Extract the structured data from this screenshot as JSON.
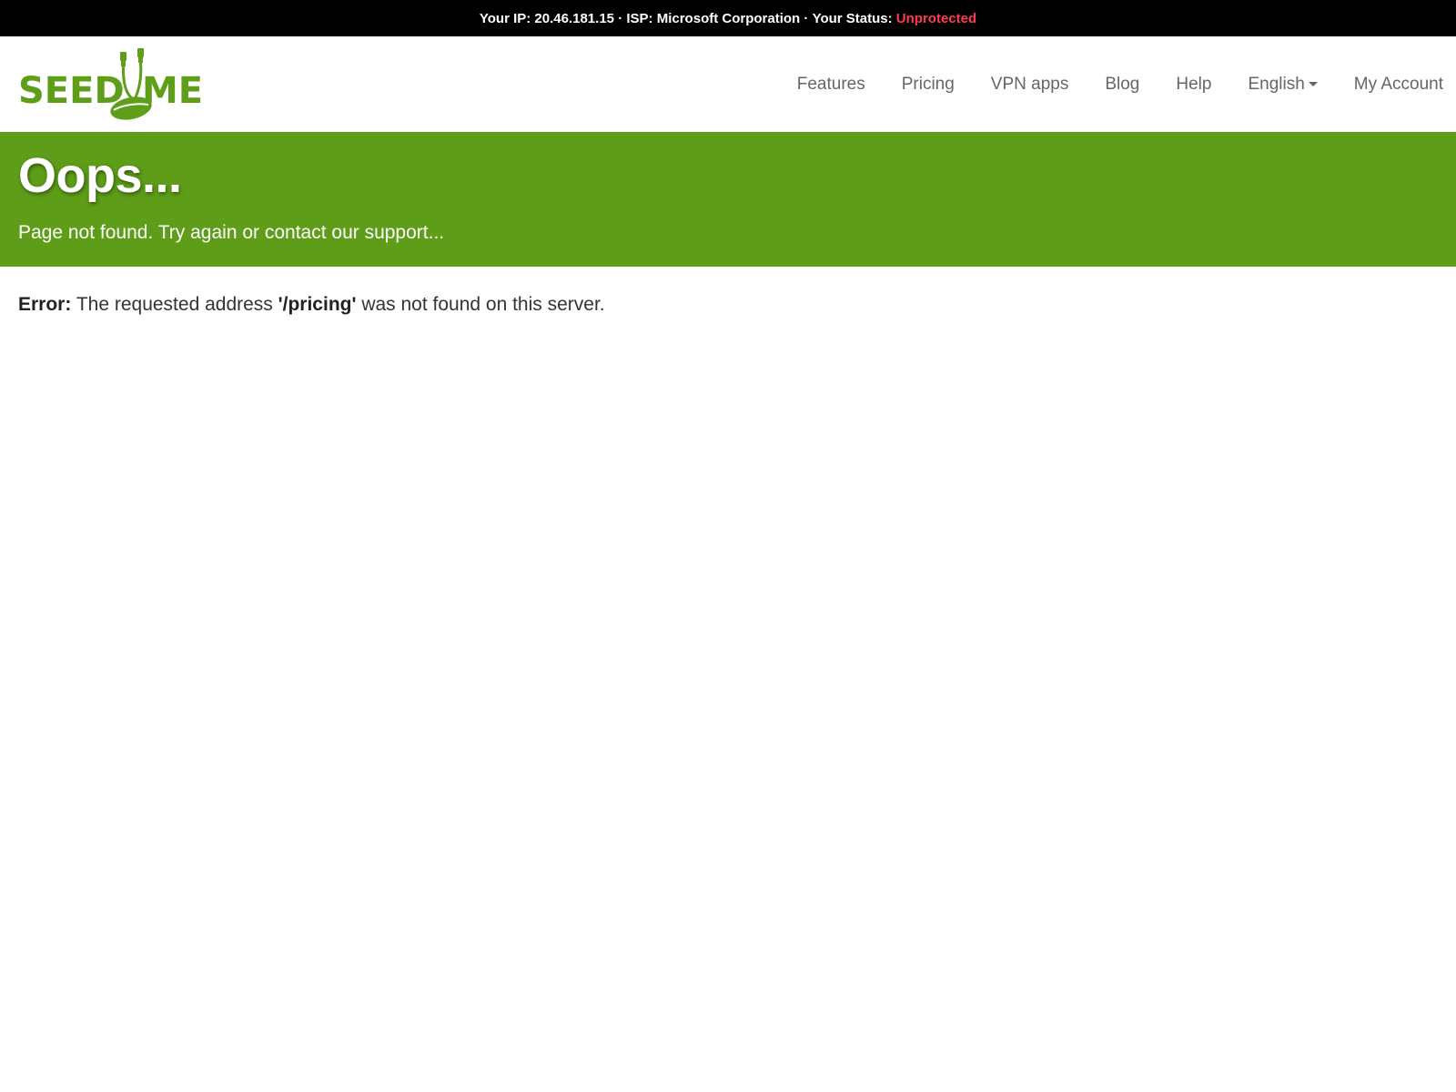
{
  "topbar": {
    "ip_label": "Your IP:",
    "ip_value": "20.46.181.15",
    "separator": "·",
    "isp_label": "ISP:",
    "isp_value": "Microsoft Corporation",
    "status_label": "Your Status:",
    "status_value": "Unprotected",
    "status_color": "#ff3b4e"
  },
  "logo": {
    "text_left": "SEED",
    "text_right": "ME",
    "brand_color": "#5e9e19",
    "icon": "seed-plug-icon"
  },
  "nav": {
    "items": [
      {
        "label": "Features"
      },
      {
        "label": "Pricing"
      },
      {
        "label": "VPN apps"
      },
      {
        "label": "Blog"
      },
      {
        "label": "Help"
      },
      {
        "label": "English",
        "icon": "caret-down-icon"
      },
      {
        "label": "My Account"
      }
    ]
  },
  "banner": {
    "title": "Oops...",
    "subtitle": "Page not found. Try again or contact our support...",
    "background_color": "#5e9e19"
  },
  "error": {
    "label": "Error:",
    "text_before": "The requested address",
    "path": "'/pricing'",
    "text_after": "was not found on this server."
  }
}
